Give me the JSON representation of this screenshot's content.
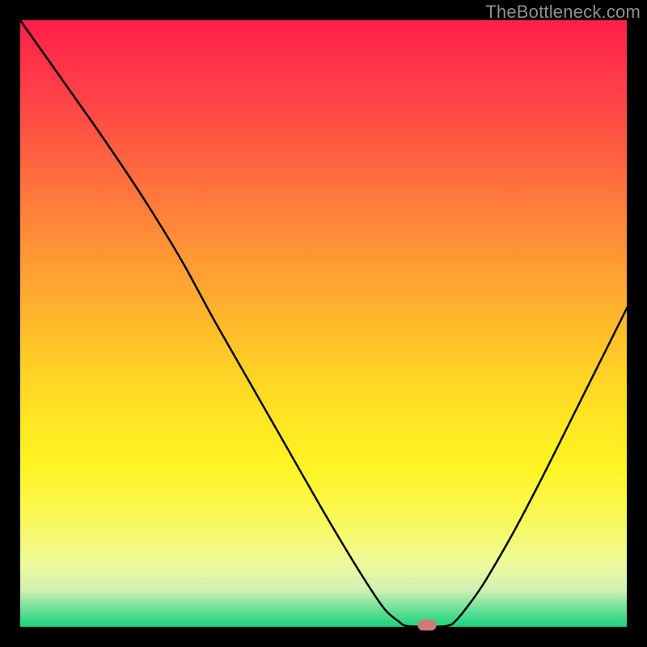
{
  "watermark": "TheBottleneck.com",
  "marker": {
    "color": "#cf7b75",
    "x_frac": 0.67,
    "y_frac": 0.997
  },
  "chart_data": {
    "type": "line",
    "title": "",
    "xlabel": "",
    "ylabel": "",
    "xlim": [
      0,
      1
    ],
    "ylim": [
      0,
      1
    ],
    "series": [
      {
        "name": "bottleneck-curve",
        "points": [
          {
            "x": 0.0,
            "y": 1.0
          },
          {
            "x": 0.06,
            "y": 0.915
          },
          {
            "x": 0.12,
            "y": 0.83
          },
          {
            "x": 0.18,
            "y": 0.742
          },
          {
            "x": 0.225,
            "y": 0.672
          },
          {
            "x": 0.27,
            "y": 0.597
          },
          {
            "x": 0.32,
            "y": 0.505
          },
          {
            "x": 0.38,
            "y": 0.4
          },
          {
            "x": 0.44,
            "y": 0.295
          },
          {
            "x": 0.5,
            "y": 0.19
          },
          {
            "x": 0.56,
            "y": 0.09
          },
          {
            "x": 0.6,
            "y": 0.03
          },
          {
            "x": 0.625,
            "y": 0.008
          },
          {
            "x": 0.64,
            "y": 0.001
          },
          {
            "x": 0.7,
            "y": 0.001
          },
          {
            "x": 0.72,
            "y": 0.012
          },
          {
            "x": 0.76,
            "y": 0.065
          },
          {
            "x": 0.81,
            "y": 0.15
          },
          {
            "x": 0.86,
            "y": 0.245
          },
          {
            "x": 0.91,
            "y": 0.345
          },
          {
            "x": 0.96,
            "y": 0.445
          },
          {
            "x": 1.0,
            "y": 0.525
          }
        ]
      }
    ],
    "annotations": []
  }
}
